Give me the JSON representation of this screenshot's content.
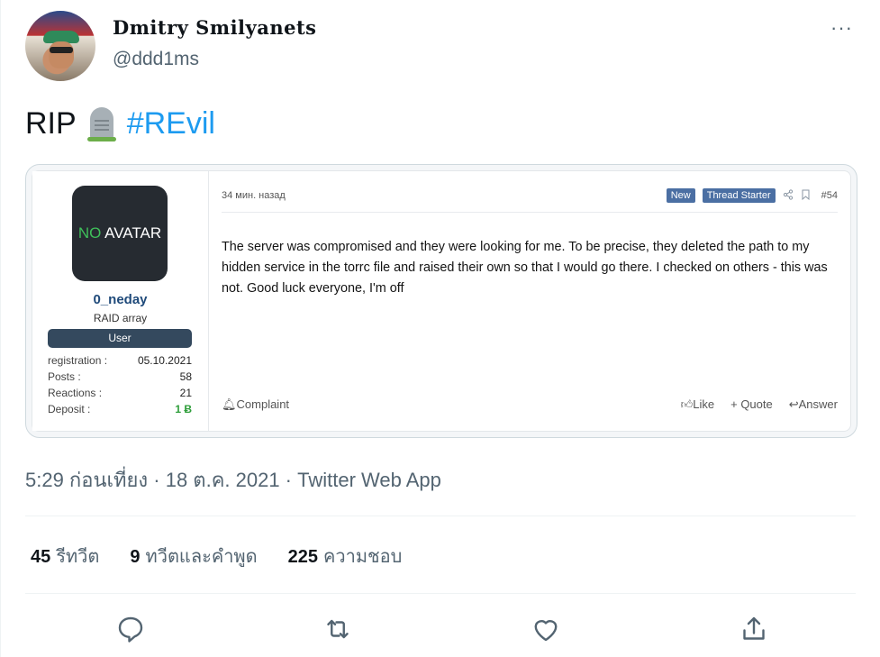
{
  "tweet": {
    "display_name": "Dmitry Smilyanets",
    "handle": "@ddd1ms",
    "text_prefix": "RIP",
    "emoji": "headstone",
    "hashtag": "#REvil",
    "more_icon": "···"
  },
  "forum_post": {
    "user": {
      "avatar_no": "NO",
      "avatar_text": " AVATAR",
      "username": "0_neday",
      "title": "RAID array",
      "badge": "User",
      "stats": [
        {
          "label": "registration :",
          "value": "05.10.2021"
        },
        {
          "label": "Posts :",
          "value": "58"
        },
        {
          "label": "Reactions :",
          "value": "21"
        },
        {
          "label": "Deposit :",
          "value": "1 Ƀ"
        }
      ]
    },
    "time": "34 мин. назад",
    "tag_new": "New",
    "tag_starter": "Thread Starter",
    "post_number": "#54",
    "body": "The server was compromised and they were looking for me. To be precise, they deleted the path to my hidden service in the torrc file and raised their own so that I would go there. I checked on others - this was not. Good luck everyone, I'm off",
    "complaint": "Complaint",
    "like": "Like",
    "quote": "+ Quote",
    "answer": "Answer"
  },
  "meta": "5:29 ก่อนเที่ยง · 18 ต.ค. 2021 · Twitter Web App",
  "counts": {
    "retweets_num": "45",
    "retweets_label": "รีทวีต",
    "quotes_num": "9",
    "quotes_label": "ทวีตและคำพูด",
    "likes_num": "225",
    "likes_label": "ความชอบ"
  },
  "colors": {
    "accent": "#1d9bf0",
    "text": "#0f1419",
    "muted": "#536471"
  }
}
